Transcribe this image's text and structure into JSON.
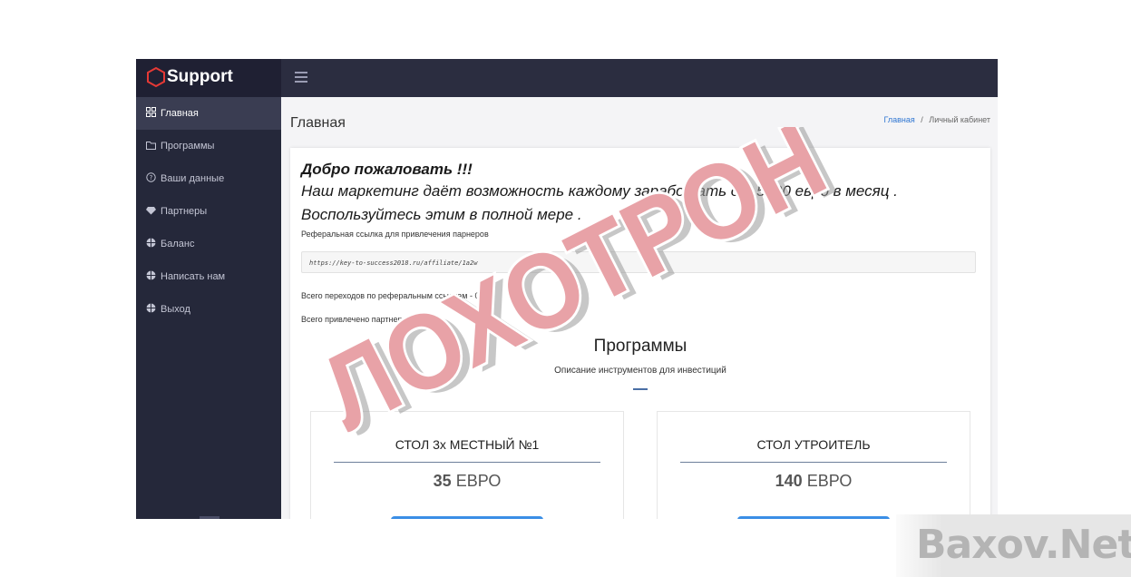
{
  "app": {
    "name": "Support"
  },
  "sidebar": {
    "items": [
      {
        "label": "Главная",
        "icon": "grid-icon",
        "active": true
      },
      {
        "label": "Программы",
        "icon": "folder-icon"
      },
      {
        "label": "Ваши данные",
        "icon": "question-circle-icon"
      },
      {
        "label": "Партнеры",
        "icon": "diamond-icon"
      },
      {
        "label": "Баланс",
        "icon": "globe-icon"
      },
      {
        "label": "Написать нам",
        "icon": "globe-icon"
      },
      {
        "label": "Выход",
        "icon": "globe-icon"
      }
    ]
  },
  "header": {
    "title": "Главная"
  },
  "breadcrumb": {
    "home": "Главная",
    "separator": "/",
    "current": "Личный кабинет"
  },
  "welcome": {
    "title": "Добро пожаловать !!!",
    "line1": "Наш маркетинг даёт возможность каждому заработать от 5300 евро в месяц .",
    "line2": "Воспользуйтесь этим в полной мере ."
  },
  "referral": {
    "label": "Реферальная ссылка для привлечения парнеров",
    "link": "https://key-to-success2018.ru/affiliate/1a2w"
  },
  "stats": {
    "clicks": "Всего переходов по реферальным ссылкам - 0",
    "partners": "Всего привлечено партнеров - 0"
  },
  "programs": {
    "title": "Программы",
    "subtitle": "Описание инструментов для инвестиций",
    "cards": [
      {
        "title": "СТОЛ 3х МЕСТНЫЙ №1",
        "amount": "35",
        "currency": "ЕВРО"
      },
      {
        "title": "СТОЛ УТРОИТЕЛЬ",
        "amount": "140",
        "currency": "ЕВРО"
      }
    ]
  },
  "stamp": {
    "text": "ЛОХОТРОН",
    "color": "#e8a2a7"
  },
  "watermark": {
    "text": "Baxov.Net"
  },
  "colors": {
    "topbar": "#2b2d40",
    "sidebar": "#25283a",
    "accent": "#2f76d2",
    "button": "#3a8ee6"
  }
}
